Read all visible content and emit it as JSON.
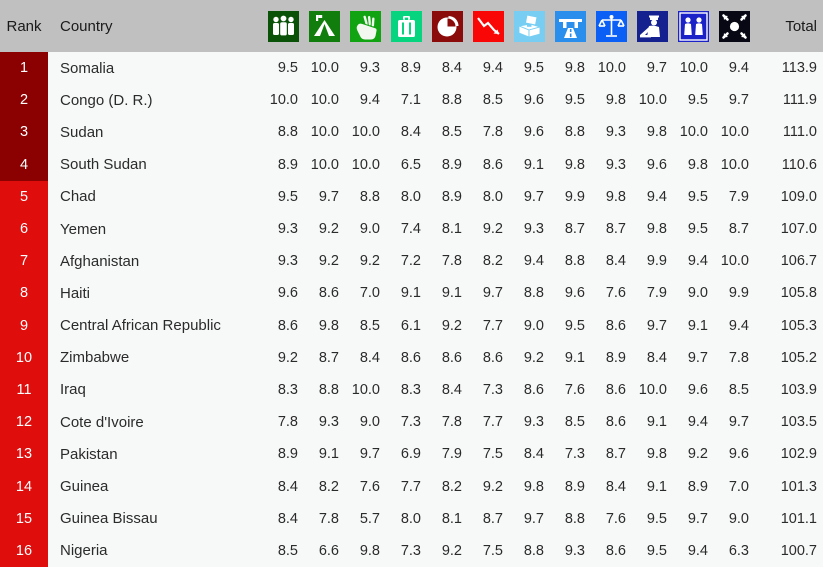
{
  "table": {
    "header": {
      "rank_label": "Rank",
      "country_label": "Country",
      "total_label": "Total",
      "indicator_icons": [
        {
          "name": "demographic-pressures-icon",
          "color": "#0b5209"
        },
        {
          "name": "refugees-idp-tent-icon",
          "color": "#117d0c"
        },
        {
          "name": "group-grievance-fist-icon",
          "color": "#12a313"
        },
        {
          "name": "human-flight-brain-drain-suitcase-icon",
          "color": "#06d47e"
        },
        {
          "name": "uneven-economic-development-piechart-icon",
          "color": "#8b0b0b"
        },
        {
          "name": "economic-decline-downtrend-icon",
          "color": "#f90606"
        },
        {
          "name": "state-legitimacy-ballot-box-icon",
          "color": "#77cef2"
        },
        {
          "name": "public-services-highway-icon",
          "color": "#2a8fec"
        },
        {
          "name": "human-rights-scales-icon",
          "color": "#0b5ff5"
        },
        {
          "name": "security-apparatus-police-icon",
          "color": "#15218e"
        },
        {
          "name": "factionalized-elites-people-icon",
          "color": "#1a22c8"
        },
        {
          "name": "external-intervention-scatter-icon",
          "color": "#080815"
        }
      ]
    },
    "rows": [
      {
        "rank": "1",
        "country": "Somalia",
        "tier": "top",
        "scores": [
          "9.5",
          "10.0",
          "9.3",
          "8.9",
          "8.4",
          "9.4",
          "9.5",
          "9.8",
          "10.0",
          "9.7",
          "10.0",
          "9.4"
        ],
        "total": "113.9"
      },
      {
        "rank": "2",
        "country": "Congo (D. R.)",
        "tier": "top",
        "scores": [
          "10.0",
          "10.0",
          "9.4",
          "7.1",
          "8.8",
          "8.5",
          "9.6",
          "9.5",
          "9.8",
          "10.0",
          "9.5",
          "9.7"
        ],
        "total": "111.9"
      },
      {
        "rank": "3",
        "country": "Sudan",
        "tier": "top",
        "scores": [
          "8.8",
          "10.0",
          "10.0",
          "8.4",
          "8.5",
          "7.8",
          "9.6",
          "8.8",
          "9.3",
          "9.8",
          "10.0",
          "10.0"
        ],
        "total": "111.0"
      },
      {
        "rank": "4",
        "country": "South Sudan",
        "tier": "top",
        "scores": [
          "8.9",
          "10.0",
          "10.0",
          "6.5",
          "8.9",
          "8.6",
          "9.1",
          "9.8",
          "9.3",
          "9.6",
          "9.8",
          "10.0"
        ],
        "total": "110.6"
      },
      {
        "rank": "5",
        "country": "Chad",
        "tier": "next",
        "scores": [
          "9.5",
          "9.7",
          "8.8",
          "8.0",
          "8.9",
          "8.0",
          "9.7",
          "9.9",
          "9.8",
          "9.4",
          "9.5",
          "7.9"
        ],
        "total": "109.0"
      },
      {
        "rank": "6",
        "country": "Yemen",
        "tier": "next",
        "scores": [
          "9.3",
          "9.2",
          "9.0",
          "7.4",
          "8.1",
          "9.2",
          "9.3",
          "8.7",
          "8.7",
          "9.8",
          "9.5",
          "8.7"
        ],
        "total": "107.0"
      },
      {
        "rank": "7",
        "country": "Afghanistan",
        "tier": "next",
        "scores": [
          "9.3",
          "9.2",
          "9.2",
          "7.2",
          "7.8",
          "8.2",
          "9.4",
          "8.8",
          "8.4",
          "9.9",
          "9.4",
          "10.0"
        ],
        "total": "106.7"
      },
      {
        "rank": "8",
        "country": "Haiti",
        "tier": "next",
        "scores": [
          "9.6",
          "8.6",
          "7.0",
          "9.1",
          "9.1",
          "9.7",
          "8.8",
          "9.6",
          "7.6",
          "7.9",
          "9.0",
          "9.9"
        ],
        "total": "105.8"
      },
      {
        "rank": "9",
        "country": "Central African Republic",
        "tier": "next",
        "scores": [
          "8.6",
          "9.8",
          "8.5",
          "6.1",
          "9.2",
          "7.7",
          "9.0",
          "9.5",
          "8.6",
          "9.7",
          "9.1",
          "9.4"
        ],
        "total": "105.3"
      },
      {
        "rank": "10",
        "country": "Zimbabwe",
        "tier": "next",
        "scores": [
          "9.2",
          "8.7",
          "8.4",
          "8.6",
          "8.6",
          "8.6",
          "9.2",
          "9.1",
          "8.9",
          "8.4",
          "9.7",
          "7.8"
        ],
        "total": "105.2"
      },
      {
        "rank": "11",
        "country": "Iraq",
        "tier": "next",
        "scores": [
          "8.3",
          "8.8",
          "10.0",
          "8.3",
          "8.4",
          "7.3",
          "8.6",
          "7.6",
          "8.6",
          "10.0",
          "9.6",
          "8.5"
        ],
        "total": "103.9"
      },
      {
        "rank": "12",
        "country": "Cote d'Ivoire",
        "tier": "next",
        "scores": [
          "7.8",
          "9.3",
          "9.0",
          "7.3",
          "7.8",
          "7.7",
          "9.3",
          "8.5",
          "8.6",
          "9.1",
          "9.4",
          "9.7"
        ],
        "total": "103.5"
      },
      {
        "rank": "13",
        "country": "Pakistan",
        "tier": "next",
        "scores": [
          "8.9",
          "9.1",
          "9.7",
          "6.9",
          "7.9",
          "7.5",
          "8.4",
          "7.3",
          "8.7",
          "9.8",
          "9.2",
          "9.6"
        ],
        "total": "102.9"
      },
      {
        "rank": "14",
        "country": "Guinea",
        "tier": "next",
        "scores": [
          "8.4",
          "8.2",
          "7.6",
          "7.7",
          "8.2",
          "9.2",
          "9.8",
          "8.9",
          "8.4",
          "9.1",
          "8.9",
          "7.0"
        ],
        "total": "101.3"
      },
      {
        "rank": "15",
        "country": "Guinea Bissau",
        "tier": "next",
        "scores": [
          "8.4",
          "7.8",
          "5.7",
          "8.0",
          "8.1",
          "8.7",
          "9.7",
          "8.8",
          "7.6",
          "9.5",
          "9.7",
          "9.0"
        ],
        "total": "101.1"
      },
      {
        "rank": "16",
        "country": "Nigeria",
        "tier": "next",
        "scores": [
          "8.5",
          "6.6",
          "9.8",
          "7.3",
          "9.2",
          "7.5",
          "8.8",
          "9.3",
          "8.6",
          "9.5",
          "9.4",
          "6.3"
        ],
        "total": "100.7"
      }
    ]
  },
  "colors": {
    "header_background": "#c0c0c0",
    "body_background": "#f7f8f8",
    "rank_tier_top": "#8b0000",
    "rank_tier_next": "#e00d0d",
    "text": "#2b2b2b"
  }
}
